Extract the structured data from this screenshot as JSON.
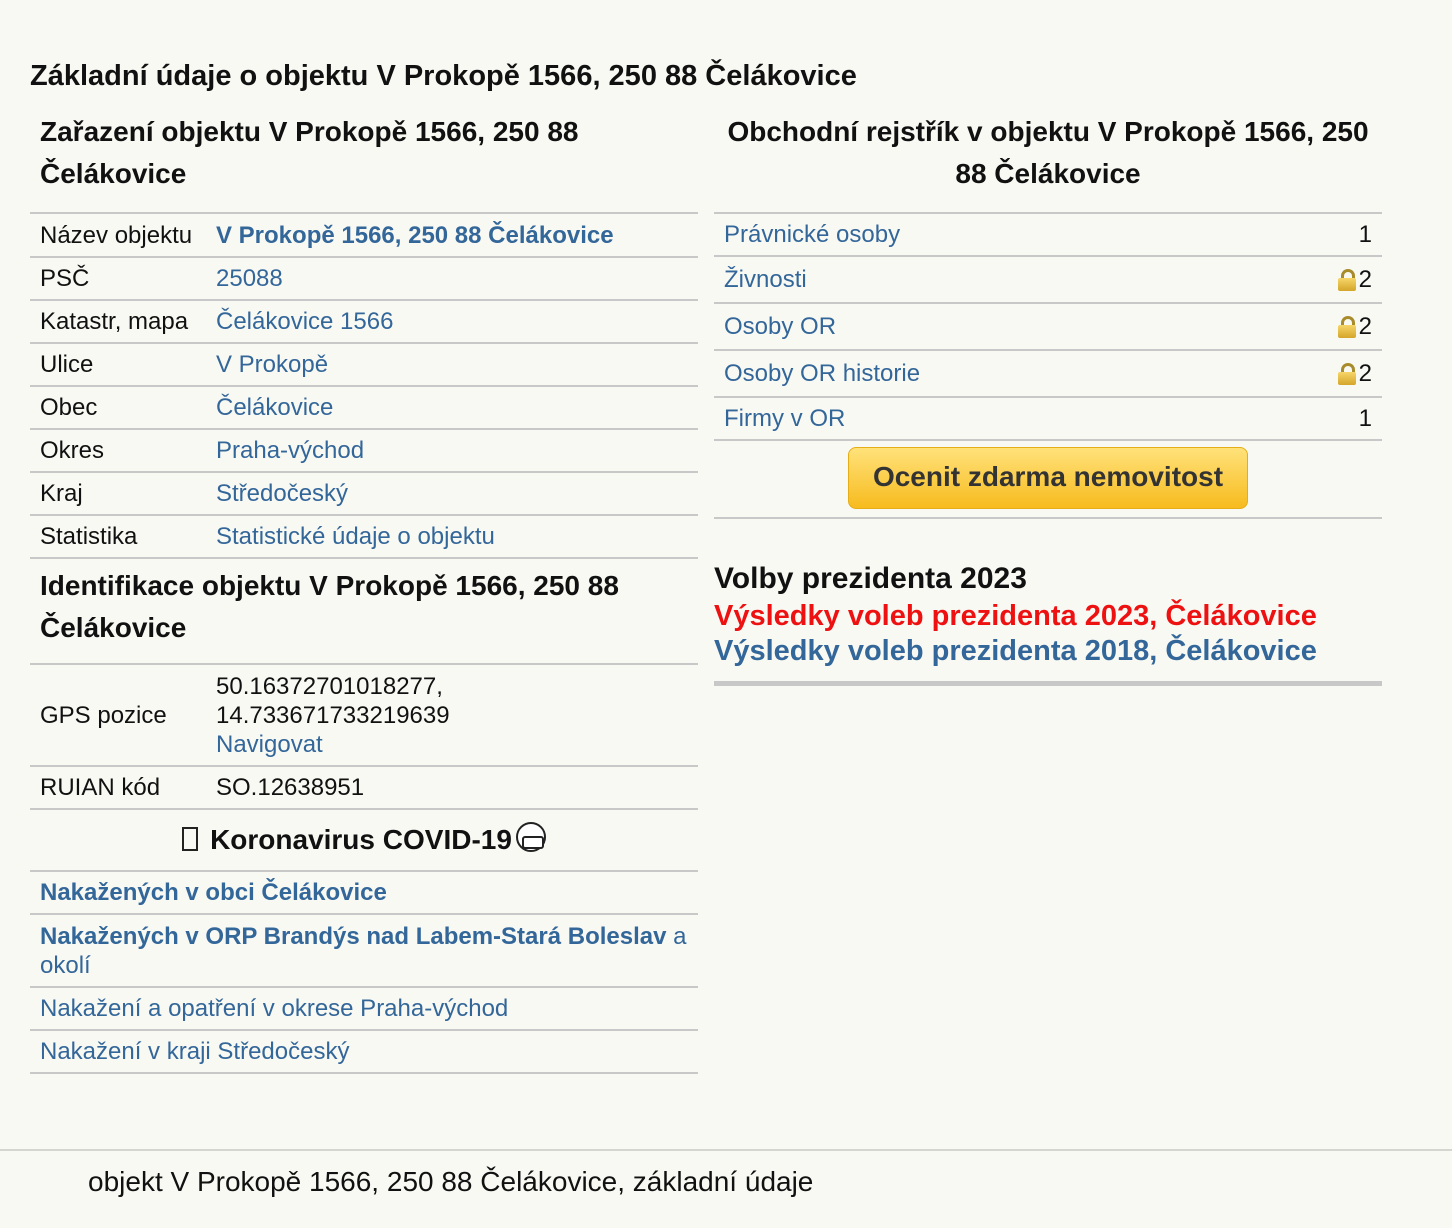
{
  "page": {
    "title": "Základní údaje o objektu V Prokopě 1566, 250 88 Čelákovice"
  },
  "classification": {
    "heading": "Zařazení objektu V Prokopě 1566, 250 88 Čelákovice",
    "rows": [
      {
        "label": "Název objektu",
        "value": "V Prokopě 1566, 250 88 Čelákovice"
      },
      {
        "label": "PSČ",
        "value": "25088"
      },
      {
        "label": "Katastr, mapa",
        "value": "Čelákovice 1566"
      },
      {
        "label": "Ulice",
        "value": "V Prokopě"
      },
      {
        "label": "Obec",
        "value": "Čelákovice"
      },
      {
        "label": "Okres",
        "value": "Praha-východ"
      },
      {
        "label": "Kraj",
        "value": "Středočeský"
      },
      {
        "label": "Statistika",
        "value": "Statistické údaje o objektu"
      }
    ]
  },
  "identification": {
    "heading": "Identifikace objektu V Prokopě 1566, 250 88 Čelákovice",
    "gps_label": "GPS pozice",
    "gps_lat": "50.16372701018277,",
    "gps_lon": "14.733671733219639",
    "navigate": "Navigovat",
    "ruian_label": "RUIAN kód",
    "ruian_value": "SO.12638951"
  },
  "covid": {
    "title": "Koronavirus COVID-19",
    "links": {
      "municipality": "Nakažených v obci Čelákovice",
      "orp_bold": "Nakažených v ORP Brandýs nad Labem-Stará Boleslav",
      "orp_suffix": " a okolí",
      "district": "Nakažení a opatření v okrese Praha-východ",
      "region": "Nakažení v kraji Středočeský"
    },
    "icons": [
      "box-glyph-icon",
      "face-mask-icon"
    ]
  },
  "business_register": {
    "heading": "Obchodní rejstřík v objektu V Prokopě 1566, 250 88 Čelákovice",
    "rows": [
      {
        "label": "Právnické osoby",
        "count": "1",
        "locked": false
      },
      {
        "label": "Živnosti",
        "count": "2",
        "locked": true
      },
      {
        "label": "Osoby OR",
        "count": "2",
        "locked": true
      },
      {
        "label": "Osoby OR historie",
        "count": "2",
        "locked": true
      },
      {
        "label": "Firmy v OR",
        "count": "1",
        "locked": false
      }
    ],
    "button": "Ocenit zdarma nemovitost"
  },
  "elections": {
    "heading": "Volby prezidenta 2023",
    "link_2023": "Výsledky voleb prezidenta 2023, Čelákovice",
    "link_2018": "Výsledky voleb prezidenta 2018, Čelákovice"
  },
  "footer": {
    "text": "objekt V Prokopě 1566, 250 88 Čelákovice, základní údaje"
  },
  "colors": {
    "link": "#336699",
    "highlight_link": "#ee1111",
    "button": "#f7bb1e",
    "background": "#f9f9f4"
  }
}
